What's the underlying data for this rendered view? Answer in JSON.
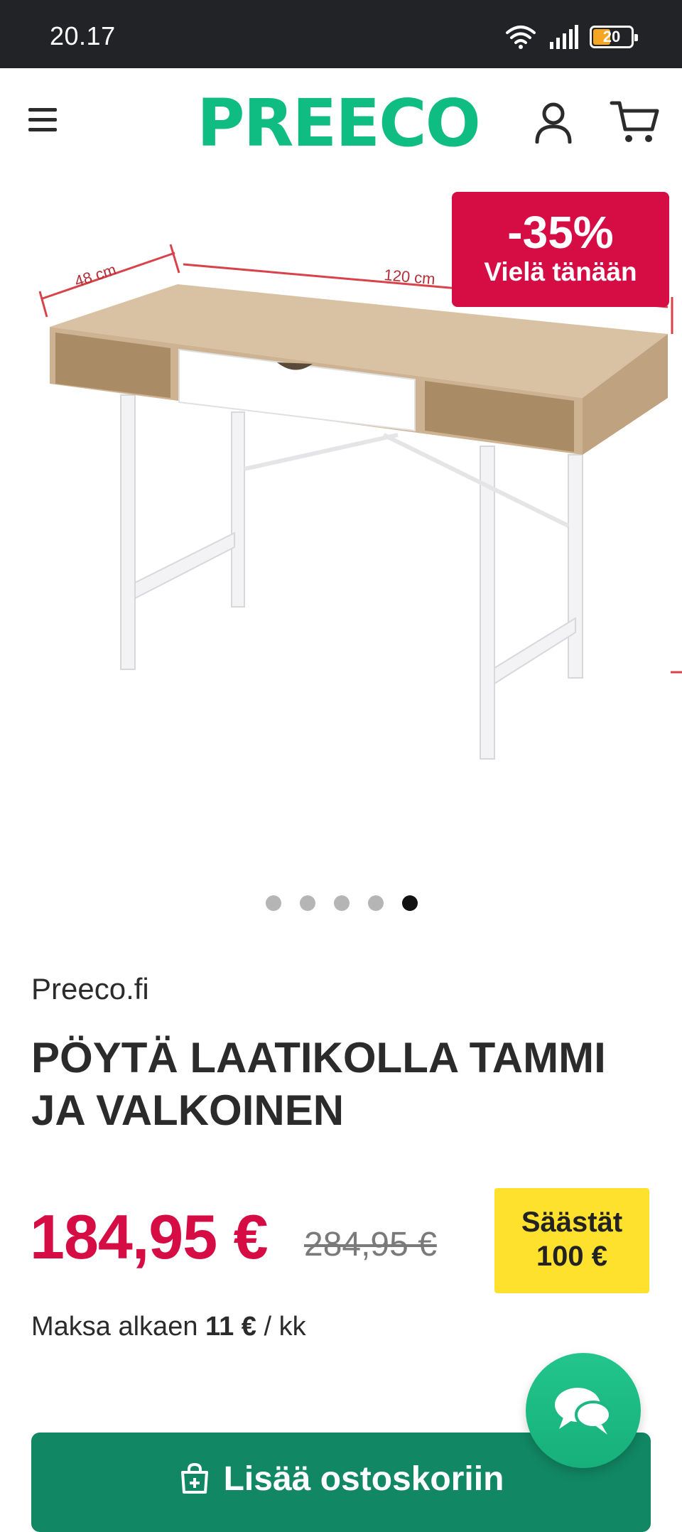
{
  "status_bar": {
    "time": "20.17",
    "battery": "20",
    "icons": [
      "wifi-icon",
      "signal-icon",
      "battery-icon"
    ]
  },
  "header": {
    "logo": "PREECO",
    "icons": [
      "menu-icon",
      "account-icon",
      "cart-icon"
    ],
    "brand_color": "#0fbd82"
  },
  "gallery": {
    "dimension_depth": "48 cm",
    "dimension_width": "120 cm",
    "slide_count": 5,
    "active_slide": 5
  },
  "sale_badge": {
    "percent": "-35%",
    "label": "Vielä tänään",
    "color": "#d60d45"
  },
  "product": {
    "brand": "Preeco.fi",
    "title": "PÖYTÄ LAATIKOLLA TAMMI JA VALKOINEN",
    "price": "184,95 €",
    "old_price": "284,95 €",
    "savings_line1": "Säästät",
    "savings_line2": "100 €",
    "installment_prefix": "Maksa alkaen",
    "installment_amount": "11 €",
    "installment_suffix": "/ kk"
  },
  "actions": {
    "add_to_cart": "Lisää ostoskoriin",
    "button_color": "#118763"
  }
}
